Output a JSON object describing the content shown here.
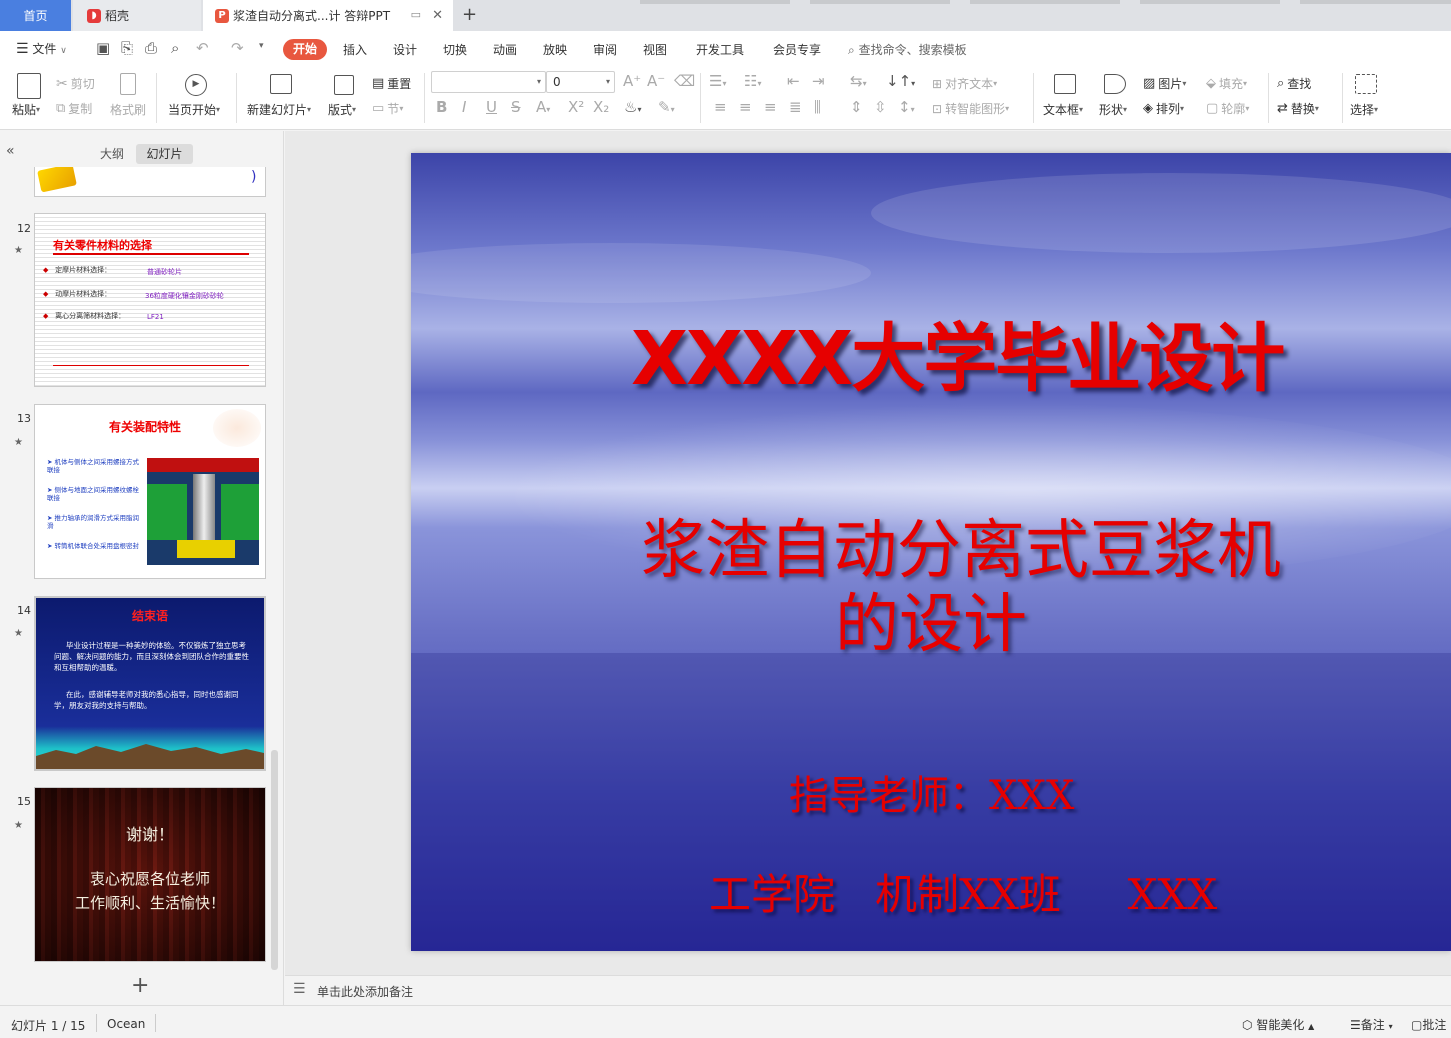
{
  "tabs": {
    "home": "首页",
    "docer": "稻壳",
    "ppt_file": "浆渣自动分离式...计 答辩PPT"
  },
  "menu": {
    "file": "文件",
    "items": [
      "开始",
      "插入",
      "设计",
      "切换",
      "动画",
      "放映",
      "审阅",
      "视图",
      "开发工具",
      "会员专享"
    ],
    "search_placeholder": "查找命令、搜索模板"
  },
  "ribbon": {
    "paste": "粘贴",
    "cut": "剪切",
    "copy": "复制",
    "format_painter": "格式刷",
    "from_current": "当页开始",
    "new_slide": "新建幻灯片",
    "layout": "版式",
    "reset": "重置",
    "section": "节",
    "font_size": "0",
    "align_text": "对齐文本",
    "to_smartart": "转智能图形",
    "text_box": "文本框",
    "shapes": "形状",
    "picture": "图片",
    "fill": "填充",
    "arrange": "排列",
    "outline": "轮廓",
    "find": "查找",
    "replace": "替换",
    "select": "选择"
  },
  "panel": {
    "outline_tab": "大纲",
    "slides_tab": "幻灯片",
    "slides": [
      {
        "num": "12",
        "title": "有关零件材料的选择",
        "rows": [
          {
            "label": "定摩片材料选择：",
            "value": "普通砂轮片"
          },
          {
            "label": "动摩片材料选择：",
            "value": "36粒度硬化镶金刚砂砂轮"
          },
          {
            "label": "离心分离筛材料选择：",
            "value": "LF21"
          }
        ]
      },
      {
        "num": "13",
        "title": "有关装配特性",
        "bullets": [
          "机体与侧体之间采用螺接方式联接",
          "侧体与地面之间采用螺纹螺栓联接",
          "推力轴承的润滑方式采用脂润滑",
          "转筒机体联合处采用盘根密封"
        ]
      },
      {
        "num": "14",
        "title": "结束语",
        "paragraphs": [
          "毕业设计过程是一种美妙的体验。不仅锻炼了独立思考问题、解决问题的能力，而且深刻体会到团队合作的重要性和互相帮助的温暖。",
          "在此，感谢辅导老师对我的悉心指导，同时也感谢同学，朋友对我的支持与帮助。"
        ]
      },
      {
        "num": "15",
        "line1": "谢谢！",
        "line2": "衷心祝愿各位老师",
        "line3": "工作顺利、生活愉快！"
      }
    ]
  },
  "slide": {
    "title": "XXXX大学毕业设计",
    "subtitle_line1": "浆渣自动分离式豆浆机",
    "subtitle_line2": "的设计",
    "advisor": "指导老师：XXX",
    "class_info": "工学院   机制XX班     XXX"
  },
  "notes_placeholder": "单击此处添加备注",
  "status": {
    "slide_counter": "幻灯片 1 / 15",
    "theme": "Ocean",
    "smart_beautify": "智能美化",
    "notes": "备注",
    "comments": "批注"
  },
  "colors": {
    "accent": "#e8573f",
    "home_tab": "#4a7fe0",
    "slide_text": "#e60000",
    "ocean_top": "#4a51b8",
    "ocean_bottom": "#2a2a9c"
  }
}
